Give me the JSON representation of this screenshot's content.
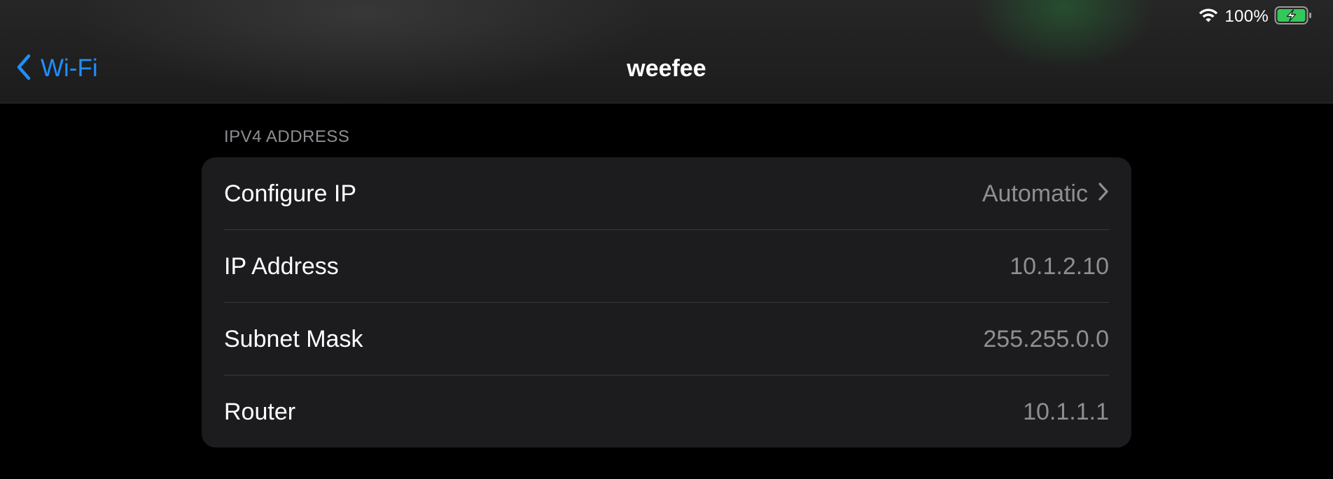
{
  "status_bar": {
    "wifi_icon": "wifi-icon",
    "battery_percent": "100%",
    "battery_icon": "battery-charging-icon",
    "battery_color": "#34c759"
  },
  "nav": {
    "back_label": "Wi-Fi",
    "back_icon": "chevron-left-icon",
    "title": "weefee",
    "accent_color": "#1f8fff"
  },
  "section": {
    "header": "IPV4 ADDRESS",
    "rows": [
      {
        "label": "Configure IP",
        "value": "Automatic",
        "disclosure": "chevron-right-icon"
      },
      {
        "label": "IP Address",
        "value": "10.1.2.10"
      },
      {
        "label": "Subnet Mask",
        "value": "255.255.0.0"
      },
      {
        "label": "Router",
        "value": "10.1.1.1"
      }
    ]
  }
}
